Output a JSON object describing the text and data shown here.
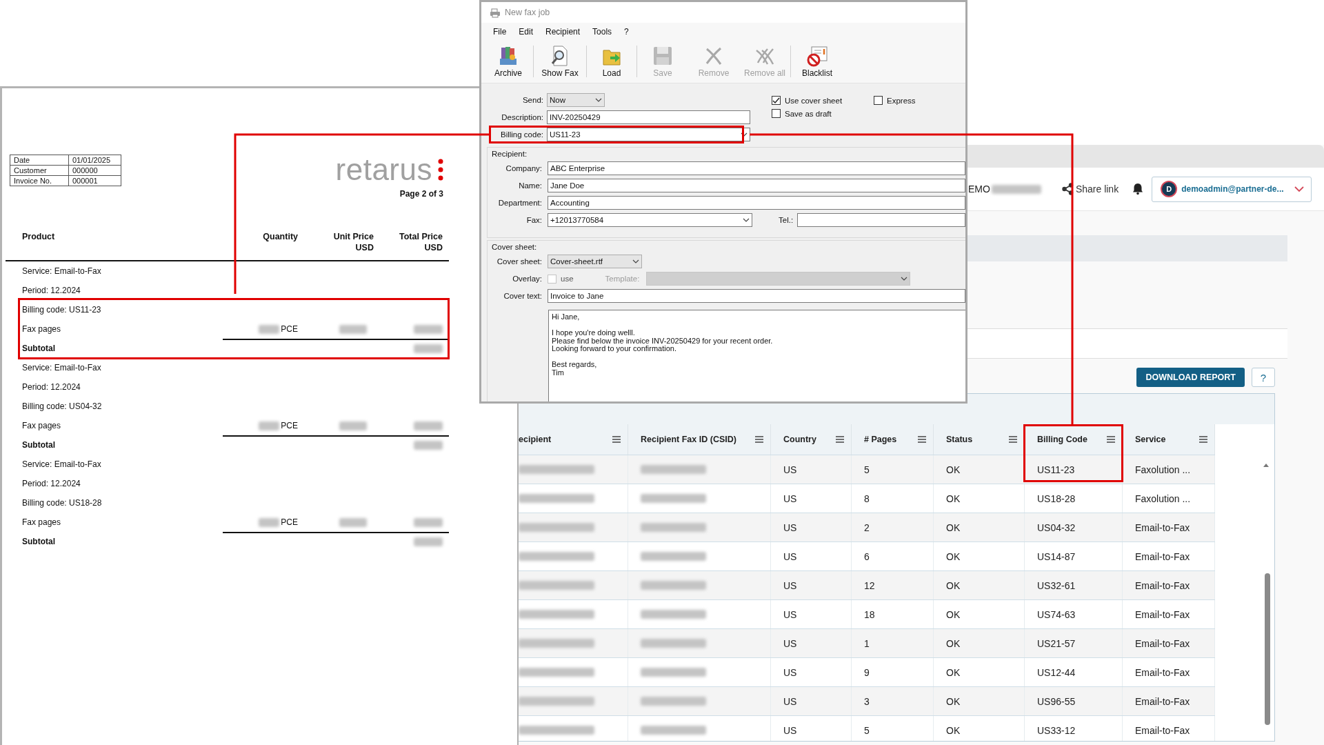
{
  "invoice": {
    "meta": [
      {
        "label": "Date",
        "value": "01/01/2025"
      },
      {
        "label": "Customer",
        "value": "000000"
      },
      {
        "label": "Invoice No.",
        "value": "000001"
      }
    ],
    "logo": "retarus",
    "page": "Page 2 of 3",
    "columns": [
      {
        "lines": [
          "Product"
        ]
      },
      {
        "lines": [
          "Quantity"
        ]
      },
      {
        "lines": [
          "Unit Price",
          "USD"
        ]
      },
      {
        "lines": [
          "Total Price",
          "USD"
        ]
      }
    ],
    "groups": [
      {
        "service": "Service: Email-to-Fax",
        "period": "Period: 12.2024",
        "billing_code": "Billing code: US11-23",
        "item": "Fax pages",
        "unit": "PCE",
        "subtotal": "Subtotal",
        "highlighted": true
      },
      {
        "service": "Service: Email-to-Fax",
        "period": "Period: 12.2024",
        "billing_code": "Billing code: US04-32",
        "item": "Fax pages",
        "unit": "PCE",
        "subtotal": "Subtotal",
        "highlighted": false
      },
      {
        "service": "Service: Email-to-Fax",
        "period": "Period: 12.2024",
        "billing_code": "Billing code: US18-28",
        "item": "Fax pages",
        "unit": "PCE",
        "subtotal": "Subtotal",
        "highlighted": false
      }
    ]
  },
  "portal": {
    "account": "EMO",
    "share": "Share link",
    "user": {
      "initial": "D",
      "email": "demoadmin@partner-de..."
    },
    "download": "DOWNLOAD REPORT",
    "help": "?",
    "table": {
      "columns": [
        {
          "label": "ecipient",
          "highlighted": false
        },
        {
          "label": "Recipient Fax ID (CSID)",
          "highlighted": false
        },
        {
          "label": "Country",
          "highlighted": false
        },
        {
          "label": "# Pages",
          "highlighted": false
        },
        {
          "label": "Status",
          "highlighted": false
        },
        {
          "label": "Billing Code",
          "highlighted": true
        },
        {
          "label": "Service",
          "highlighted": false
        }
      ],
      "rows": [
        {
          "country": "US",
          "pages": "5",
          "status": "OK",
          "billing_code": "US11-23",
          "service": "Faxolution ..."
        },
        {
          "country": "US",
          "pages": "8",
          "status": "OK",
          "billing_code": "US18-28",
          "service": "Faxolution ..."
        },
        {
          "country": "US",
          "pages": "2",
          "status": "OK",
          "billing_code": "US04-32",
          "service": "Email-to-Fax"
        },
        {
          "country": "US",
          "pages": "6",
          "status": "OK",
          "billing_code": "US14-87",
          "service": "Email-to-Fax"
        },
        {
          "country": "US",
          "pages": "12",
          "status": "OK",
          "billing_code": "US32-61",
          "service": "Email-to-Fax"
        },
        {
          "country": "US",
          "pages": "18",
          "status": "OK",
          "billing_code": "US74-63",
          "service": "Email-to-Fax"
        },
        {
          "country": "US",
          "pages": "1",
          "status": "OK",
          "billing_code": "US21-57",
          "service": "Email-to-Fax"
        },
        {
          "country": "US",
          "pages": "9",
          "status": "OK",
          "billing_code": "US12-44",
          "service": "Email-to-Fax"
        },
        {
          "country": "US",
          "pages": "3",
          "status": "OK",
          "billing_code": "US96-55",
          "service": "Email-to-Fax"
        },
        {
          "country": "US",
          "pages": "5",
          "status": "OK",
          "billing_code": "US33-12",
          "service": "Email-to-Fax"
        }
      ]
    }
  },
  "fax_window": {
    "title": "New fax job",
    "menu": [
      "File",
      "Edit",
      "Recipient",
      "Tools",
      "?"
    ],
    "toolbar": [
      {
        "kind": "archive",
        "label": "Archive",
        "disabled": false
      },
      {
        "kind": "show",
        "label": "Show Fax",
        "disabled": false
      },
      {
        "kind": "load",
        "label": "Load",
        "disabled": false
      },
      {
        "kind": "save",
        "label": "Save",
        "disabled": true
      },
      {
        "kind": "remove",
        "label": "Remove",
        "disabled": true
      },
      {
        "kind": "remove_all",
        "label": "Remove all",
        "disabled": true
      },
      {
        "kind": "blacklist",
        "label": "Blacklist",
        "disabled": false
      }
    ],
    "send": {
      "label": "Send:",
      "value": "Now"
    },
    "description": {
      "label": "Description:",
      "value": "INV-20250429"
    },
    "billing_code": {
      "label": "Billing code:",
      "value": "US11-23",
      "highlighted": true
    },
    "options": [
      {
        "label": "Use cover sheet",
        "checked": true
      },
      {
        "label": "Express",
        "checked": false
      },
      {
        "label": "Save as draft",
        "checked": false
      }
    ],
    "recipient": {
      "title": "Recipient:",
      "fields": [
        {
          "label": "Company:",
          "value": "ABC Enterprise"
        },
        {
          "label": "Name:",
          "value": "Jane Doe"
        },
        {
          "label": "Department:",
          "value": "Accounting"
        }
      ],
      "fax": {
        "label": "Fax:",
        "value": "+12013770584"
      },
      "tel": {
        "label": "Tel.:"
      }
    },
    "cover_sheet": {
      "title": "Cover sheet:",
      "sheet": {
        "label": "Cover sheet:",
        "value": "Cover-sheet.rtf"
      },
      "overlay": {
        "label": "Overlay:",
        "option": "use",
        "checked": false,
        "disabled": true
      },
      "template": {
        "label": "Template:",
        "disabled": true
      },
      "cover_text": {
        "label": "Cover text:",
        "value": "Invoice to Jane"
      },
      "message": "Hi Jane,\n\nI hope you're doing welll.\nPlease find below the invoice INV-20250429 for your recent order.\nLooking forward to your confirmation.\n\nBest regards,\nTim"
    }
  }
}
